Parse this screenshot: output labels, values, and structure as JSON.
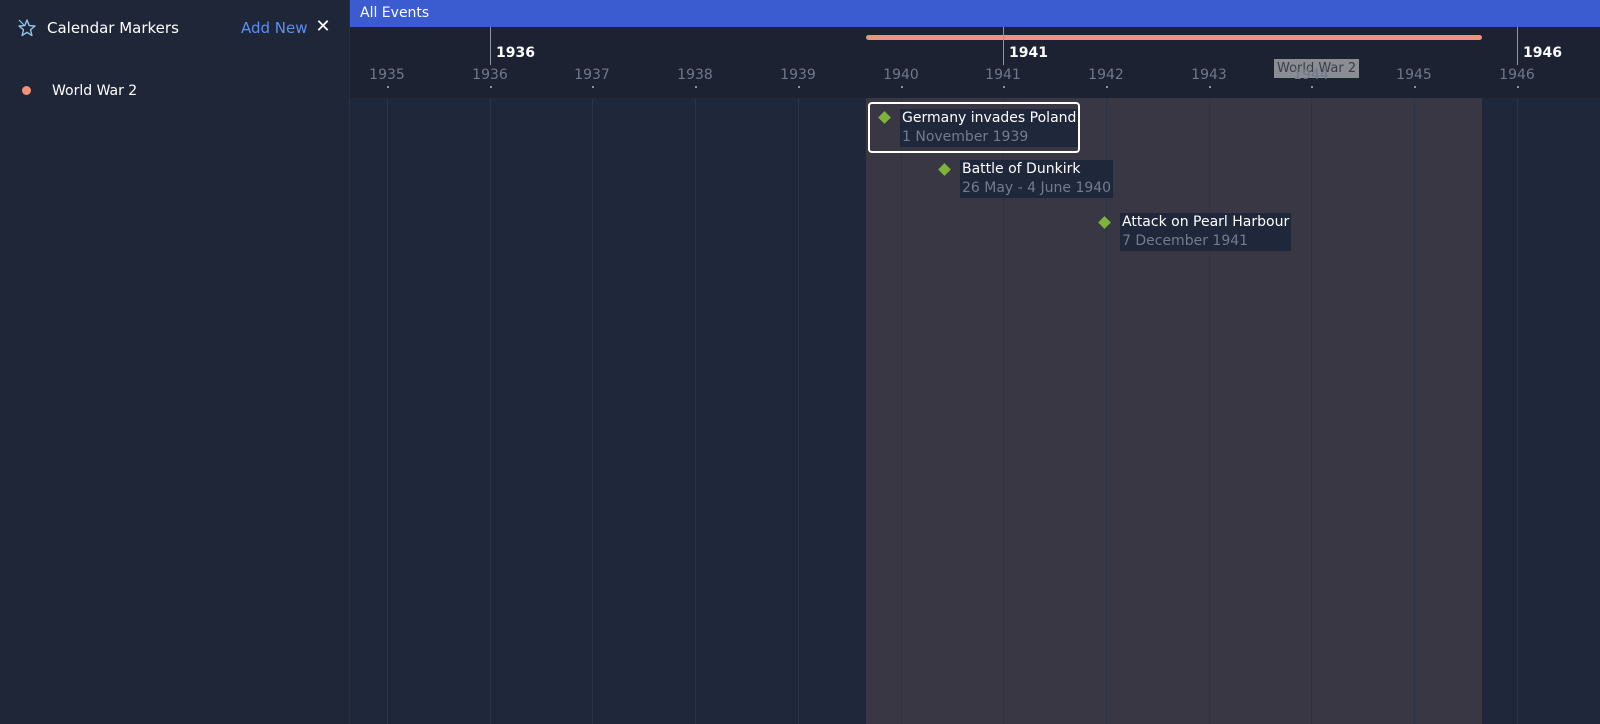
{
  "sidebar": {
    "title": "Calendar Markers",
    "add_new_label": "Add New",
    "close_glyph": "✕",
    "icon": "star-outline-icon",
    "markers": [
      {
        "label": "World War 2",
        "color": "#f0937a"
      }
    ]
  },
  "timeline": {
    "group_label": "All Events",
    "major_ticks": [
      "1936",
      "1941",
      "1946"
    ],
    "minor_ticks": [
      "1935",
      "1936",
      "1937",
      "1938",
      "1939",
      "1940",
      "1941",
      "1942",
      "1943",
      "1944",
      "1945",
      "1946"
    ],
    "marker_range": {
      "label": "World War 2",
      "start": "1939-09-01",
      "end": "1945-09-02",
      "color": "#f0937a"
    },
    "events": [
      {
        "title": "Germany invades Poland",
        "date": "1 November 1939",
        "selected": true,
        "color": "#7db33a"
      },
      {
        "title": "Battle of Dunkirk",
        "date": "26 May - 4 June 1940",
        "selected": false,
        "color": "#7db33a"
      },
      {
        "title": "Attack on Pearl Harbour",
        "date": "7 December 1941",
        "selected": false,
        "color": "#7db33a"
      }
    ]
  },
  "colors": {
    "accent_blue": "#3b5bd0",
    "link_blue": "#5b8ff5",
    "background": "#1f273a",
    "range_shade": "#393744"
  }
}
